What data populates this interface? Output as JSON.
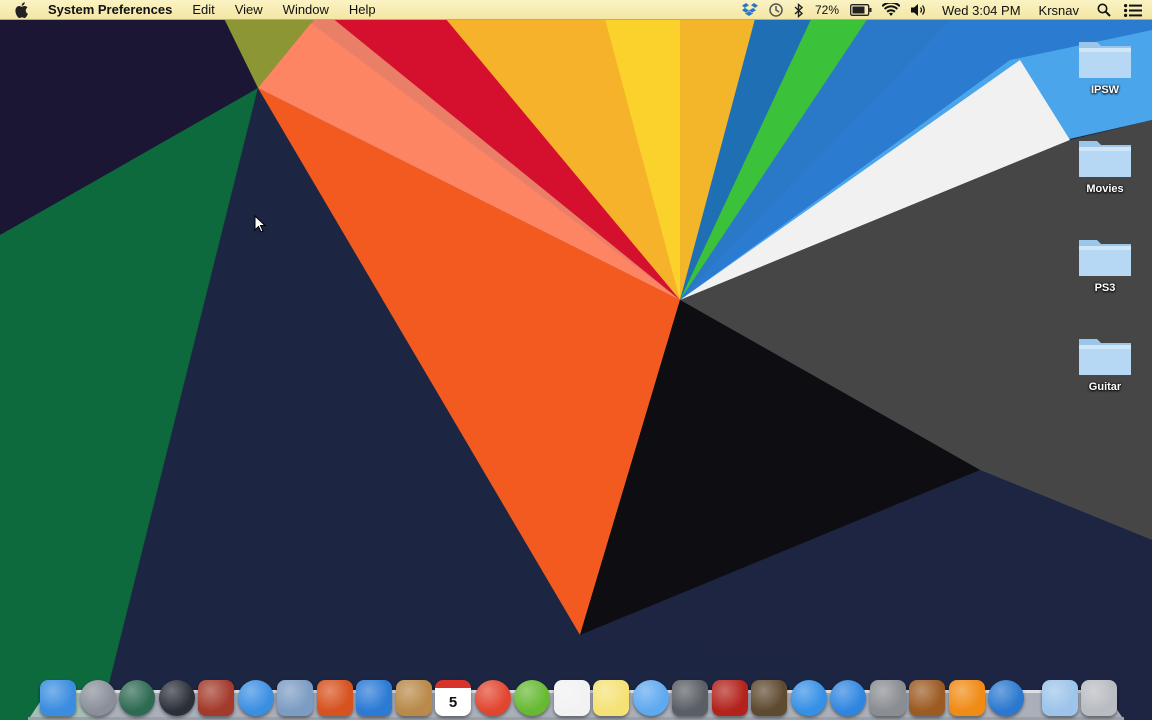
{
  "menubar": {
    "app_name": "System Preferences",
    "menus": [
      "Edit",
      "View",
      "Window",
      "Help"
    ],
    "battery": "72%",
    "clock": "Wed 3:04 PM",
    "user": "Krsnav",
    "icons": [
      "dropbox-icon",
      "time-machine-icon",
      "bluetooth-icon",
      "battery-icon",
      "wifi-icon",
      "volume-icon",
      "spotlight-icon",
      "notification-center-icon"
    ]
  },
  "desktop": {
    "folders": [
      {
        "label": "IPSW"
      },
      {
        "label": "Movies"
      },
      {
        "label": "PS3"
      },
      {
        "label": "Guitar"
      }
    ]
  },
  "dock": {
    "apps": [
      {
        "name": "finder",
        "color": "#3a8de0"
      },
      {
        "name": "launchpad",
        "color": "#8a8f99"
      },
      {
        "name": "time-machine",
        "color": "#2d6a52"
      },
      {
        "name": "dashboard",
        "color": "#2b2f38"
      },
      {
        "name": "photo-booth",
        "color": "#a33b2c"
      },
      {
        "name": "safari",
        "color": "#3b8fe3"
      },
      {
        "name": "mail",
        "color": "#7d9cc4"
      },
      {
        "name": "powerpoint",
        "color": "#d7521f"
      },
      {
        "name": "word",
        "color": "#2b7ad6"
      },
      {
        "name": "address-book",
        "color": "#b98a4a"
      },
      {
        "name": "calendar",
        "color": "#ffffff"
      },
      {
        "name": "chrome",
        "color": "#e2452f"
      },
      {
        "name": "utorrent",
        "color": "#67b932"
      },
      {
        "name": "reminders",
        "color": "#f2f2f2"
      },
      {
        "name": "stickies",
        "color": "#f5e277"
      },
      {
        "name": "messages",
        "color": "#5ea9f0"
      },
      {
        "name": "facetime",
        "color": "#5a5f66"
      },
      {
        "name": "photo-slideshow",
        "color": "#b3231c"
      },
      {
        "name": "iphoto",
        "color": "#5e4a2f"
      },
      {
        "name": "itunes",
        "color": "#3590e6"
      },
      {
        "name": "app-store",
        "color": "#2f86e1"
      },
      {
        "name": "system-preferences",
        "color": "#8a8d92"
      },
      {
        "name": "garageband",
        "color": "#9c5b23"
      },
      {
        "name": "vlc",
        "color": "#f08b15"
      },
      {
        "name": "quicktime",
        "color": "#2a78cf"
      },
      {
        "name": "downloads-stack",
        "color": "#9dc4ea"
      },
      {
        "name": "trash",
        "color": "#b9bcc1"
      }
    ],
    "calendar_day": "5"
  }
}
